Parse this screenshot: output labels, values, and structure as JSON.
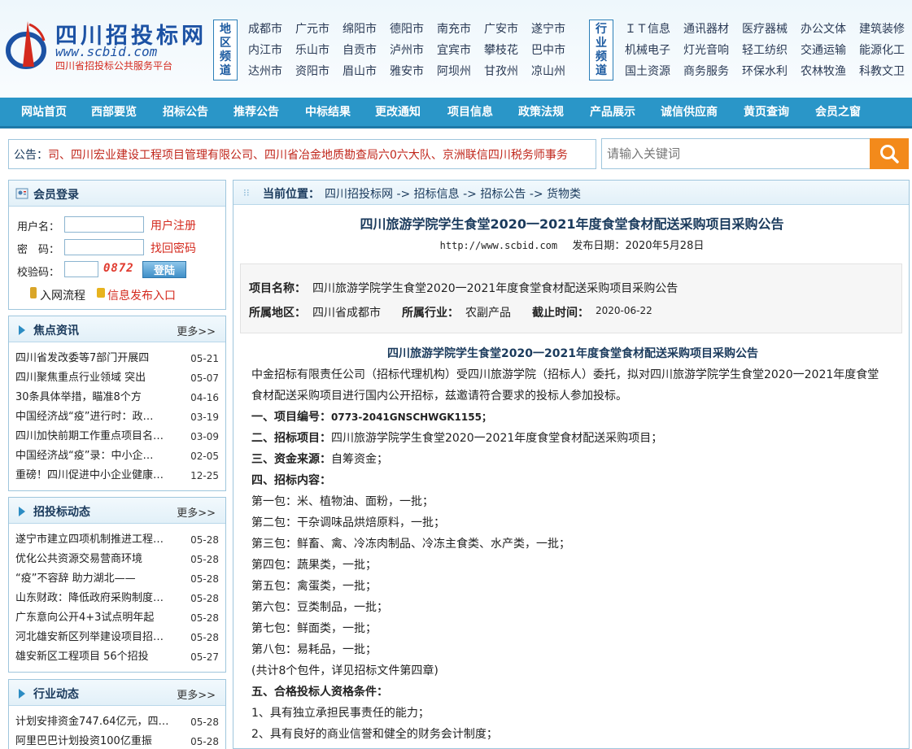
{
  "site": {
    "name": "四川招投标网",
    "url": "www.scbid.com",
    "subtitle": "四川省招投标公共服务平台"
  },
  "region_channel": {
    "label": "地区频道",
    "cities": [
      "成都市",
      "广元市",
      "绵阳市",
      "德阳市",
      "南充市",
      "广安市",
      "遂宁市",
      "内江市",
      "乐山市",
      "自贡市",
      "泸州市",
      "宜宾市",
      "攀枝花",
      "巴中市",
      "达州市",
      "资阳市",
      "眉山市",
      "雅安市",
      "阿坝州",
      "甘孜州",
      "凉山州"
    ]
  },
  "industry_channel": {
    "label": "行业频道",
    "items": [
      "ＩＴ信息",
      "通讯器材",
      "医疗器械",
      "办公文体",
      "建筑装修",
      "机械电子",
      "灯光音响",
      "轻工纺织",
      "交通运输",
      "能源化工",
      "国土资源",
      "商务服务",
      "环保水利",
      "农林牧渔",
      "科教文卫"
    ]
  },
  "nav": [
    "网站首页",
    "西部要览",
    "招标公告",
    "推荐公告",
    "中标结果",
    "更改通知",
    "项目信息",
    "政策法规",
    "产品展示",
    "诚信供应商",
    "黄页查询",
    "会员之窗"
  ],
  "notice": {
    "label": "公告：",
    "text": "司、四川宏业建设工程项目管理有限公司、四川省冶金地质勘查局六0六大队、京洲联信四川税务师事务"
  },
  "search": {
    "placeholder": "请输入关键词"
  },
  "login": {
    "title": "会员登录",
    "username_label": "用户名：",
    "password_label": "密　码：",
    "captcha_label": "校验码：",
    "captcha_value": "0872",
    "register": "用户注册",
    "recover": "找回密码",
    "login_button": "登陆",
    "process_link": "入网流程",
    "publish_link": "信息发布入口"
  },
  "focus_news": {
    "title": "焦点资讯",
    "more": "更多>>",
    "items": [
      {
        "text": "四川省发改委等7部门开展四",
        "date": "05-21"
      },
      {
        "text": "四川聚焦重点行业领域 突出",
        "date": "05-07"
      },
      {
        "text": "30条具体举措，瞄准8个方",
        "date": "04-16"
      },
      {
        "text": "中国经济战“疫”进行时：政…",
        "date": "03-19"
      },
      {
        "text": "四川加快前期工作重点项目名…",
        "date": "03-09"
      },
      {
        "text": "中国经济战“疫”录：中小企…",
        "date": "02-05"
      },
      {
        "text": "重磅！四川促进中小企业健康…",
        "date": "12-25"
      }
    ]
  },
  "bidding_news": {
    "title": "招投标动态",
    "more": "更多>>",
    "items": [
      {
        "text": "遂宁市建立四项机制推进工程…",
        "date": "05-28"
      },
      {
        "text": "优化公共资源交易营商环境",
        "date": "05-28"
      },
      {
        "text": "“疫”不容辞 助力湖北——",
        "date": "05-28"
      },
      {
        "text": "山东财政：降低政府采购制度…",
        "date": "05-28"
      },
      {
        "text": "广东意向公开4+3试点明年起",
        "date": "05-28"
      },
      {
        "text": "河北雄安新区列举建设项目招…",
        "date": "05-28"
      },
      {
        "text": "雄安新区工程项目 56个招投",
        "date": "05-27"
      }
    ]
  },
  "industry_news": {
    "title": "行业动态",
    "more": "更多>>",
    "items": [
      {
        "text": "计划安排资金747.64亿元，四…",
        "date": "05-28"
      },
      {
        "text": "阿里巴巴计划投资100亿重振",
        "date": "05-28"
      }
    ]
  },
  "breadcrumb": {
    "label": "当前位置：",
    "path": "四川招投标网 -> 招标信息 -> 招标公告 -> 货物类"
  },
  "article": {
    "title": "四川旅游学院学生食堂2020一2021年度食堂食材配送采购项目采购公告",
    "site_url": "http://www.scbid.com",
    "publish_label": "发布日期：",
    "publish_date": "2020年5月28日",
    "project_name_label": "项目名称：",
    "project_name": "四川旅游学院学生食堂2020一2021年度食堂食材配送采购项目采购公告",
    "region_label": "所属地区：",
    "region": "四川省成都市",
    "industry_label": "所属行业：",
    "industry": "农副产品",
    "deadline_label": "截止时间：",
    "deadline": "2020-06-22",
    "body_title": "四川旅游学院学生食堂2020一2021年度食堂食材配送采购项目采购公告",
    "intro1": "中金招标有限责任公司（招标代理机构）受四川旅游学院（招标人）委托，拟对四川旅游学院学生食堂2020一2021年度食堂",
    "intro2": "食材配送采购项目进行国内公开招标，兹邀请符合要求的投标人参加投标。",
    "s1_label": "一、项目编号：",
    "s1_value": "0773-2041GNSCHWGK1155；",
    "s2_label": "二、招标项目：",
    "s2_value": "四川旅游学院学生食堂2020一2021年度食堂食材配送采购项目；",
    "s3_label": "三、资金来源：",
    "s3_value": "自筹资金；",
    "s4_label": "四、招标内容：",
    "packages": [
      "第一包：米、植物油、面粉，一批；",
      "第二包：干杂调味品烘焙原料，一批；",
      "第三包：鲜畜、禽、冷冻肉制品、冷冻主食类、水产类，一批；",
      "第四包：蔬果类，一批；",
      "第五包：禽蛋类，一批；",
      "第六包：豆类制品，一批；",
      "第七包：鲜面类，一批；",
      "第八包：易耗品，一批；",
      "(共计8个包件，详见招标文件第四章)"
    ],
    "s5_label": "五、合格投标人资格条件：",
    "conditions": [
      "1、具有独立承担民事责任的能力；",
      "2、具有良好的商业信誉和健全的财务会计制度；"
    ]
  },
  "colors": {
    "nav_bg": "#2a96c8",
    "brand_blue": "#1c52a4",
    "brand_red": "#d42a1e",
    "search_button": "#f38a1b"
  }
}
